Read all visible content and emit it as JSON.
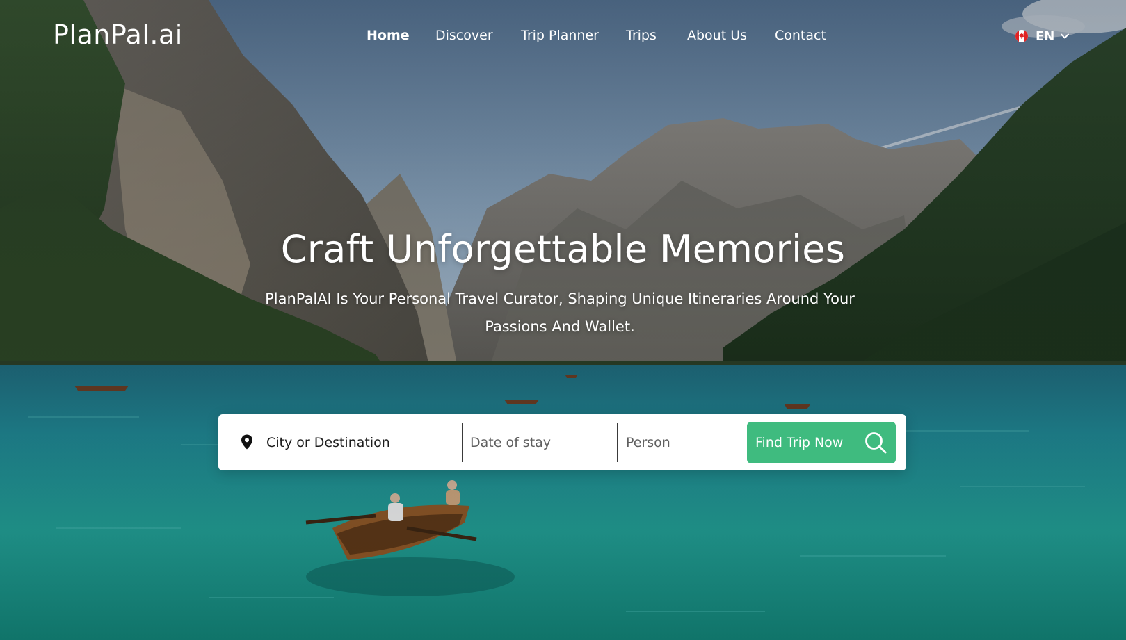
{
  "brand": {
    "logo_text": "PlanPal.ai"
  },
  "nav": {
    "items": [
      {
        "label": "Home",
        "active": true
      },
      {
        "label": "Discover",
        "active": false
      },
      {
        "label": "Trip Planner",
        "active": false
      },
      {
        "label": "Trips",
        "active": false
      },
      {
        "label": "About Us",
        "active": false
      },
      {
        "label": "Contact",
        "active": false
      }
    ]
  },
  "language": {
    "flag_icon": "canada-flag-icon",
    "label": "EN",
    "dropdown_icon": "chevron-down-icon"
  },
  "hero": {
    "title": "Craft Unforgettable Memories",
    "subtitle": "PlanPalAI Is Your Personal Travel Curator, Shaping Unique Itineraries Around Your Passions And Wallet."
  },
  "search": {
    "location_icon": "map-pin-icon",
    "destination_placeholder": "City or Destination",
    "date_placeholder": "Date of stay",
    "person_placeholder": "Person",
    "button_label": "Find Trip Now",
    "button_icon": "search-icon"
  },
  "colors": {
    "accent": "#3fbb7f",
    "text_light": "#ffffff",
    "search_bg": "#ffffff"
  }
}
